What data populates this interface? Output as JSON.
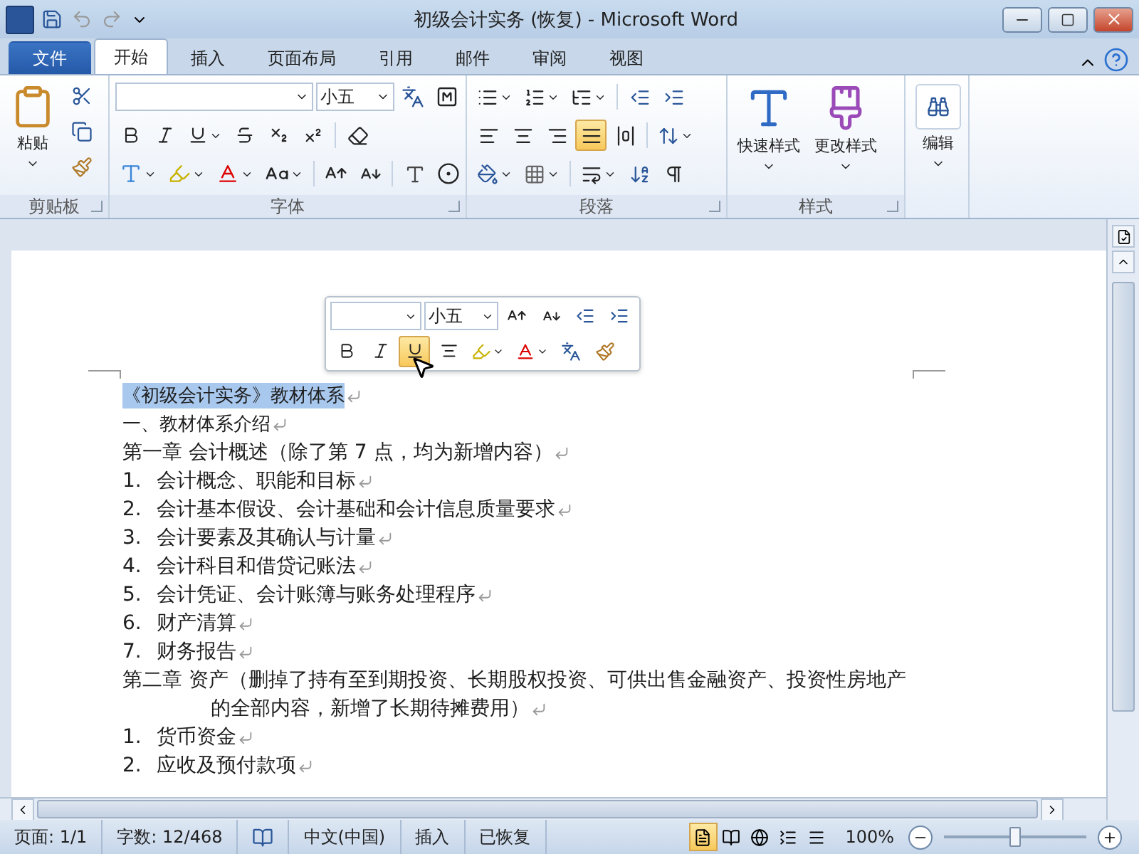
{
  "window": {
    "title": "初级会计实务 (恢复) - Microsoft Word"
  },
  "ribbon_tabs": [
    {
      "label": "文件",
      "kind": "file",
      "selected": false
    },
    {
      "label": "开始",
      "kind": "tab",
      "selected": true
    },
    {
      "label": "插入",
      "kind": "tab",
      "selected": false
    },
    {
      "label": "页面布局",
      "kind": "tab",
      "selected": false
    },
    {
      "label": "引用",
      "kind": "tab",
      "selected": false
    },
    {
      "label": "邮件",
      "kind": "tab",
      "selected": false
    },
    {
      "label": "审阅",
      "kind": "tab",
      "selected": false
    },
    {
      "label": "视图",
      "kind": "tab",
      "selected": false
    }
  ],
  "clipboard": {
    "paste_label": "粘贴",
    "group_label": "剪贴板"
  },
  "font": {
    "size": "小五",
    "group_label": "字体"
  },
  "paragraph": {
    "group_label": "段落",
    "alignments": [
      {
        "kind": "left",
        "selected": false
      },
      {
        "kind": "center",
        "selected": false
      },
      {
        "kind": "right",
        "selected": false
      },
      {
        "kind": "justify",
        "selected": true
      },
      {
        "kind": "distributed",
        "selected": false
      }
    ]
  },
  "styles": {
    "quick_styles": "快速样式",
    "change_styles": "更改样式",
    "group_label": "样式"
  },
  "editing": {
    "label": "编辑"
  },
  "mini_toolbar": {
    "size": "小五",
    "underline": {
      "selected": true
    }
  },
  "document": {
    "lines": [
      {
        "kind": "heading",
        "text": "《初级会计实务》教材体系",
        "selected": true
      },
      {
        "kind": "plain",
        "text": "一、教材体系介绍",
        "selected": false
      },
      {
        "kind": "chapter",
        "text": "第一章  会计概述（除了第 7 点，均为新增内容）",
        "selected": false
      },
      {
        "kind": "numbered",
        "number": "1.",
        "text": "会计概念、职能和目标",
        "selected": false
      },
      {
        "kind": "numbered",
        "number": "2.",
        "text": "会计基本假设、会计基础和会计信息质量要求",
        "selected": false
      },
      {
        "kind": "numbered",
        "number": "3.",
        "text": "会计要素及其确认与计量",
        "selected": false
      },
      {
        "kind": "numbered",
        "number": "4.",
        "text": "会计科目和借贷记账法",
        "selected": false
      },
      {
        "kind": "numbered",
        "number": "5.",
        "text": "会计凭证、会计账簿与账务处理程序",
        "selected": false
      },
      {
        "kind": "numbered",
        "number": "6.",
        "text": "财产清算",
        "selected": false
      },
      {
        "kind": "numbered",
        "number": "7.",
        "text": "财务报告",
        "selected": false
      },
      {
        "kind": "chapter_open",
        "text": "第二章  资产（删掉了持有至到期投资、长期股权投资、可供出售金融资产、投资性房地产",
        "selected": false
      },
      {
        "kind": "continuation",
        "text": "的全部内容，新增了长期待摊费用）",
        "selected": false
      },
      {
        "kind": "numbered",
        "number": "1.",
        "text": "货币资金",
        "selected": false
      },
      {
        "kind": "numbered",
        "number": "2.",
        "text": "应收及预付款项",
        "selected": false
      }
    ]
  },
  "status_bar": {
    "page": "页面: 1/1",
    "word_count": "字数: 12/468",
    "language": "中文(中国)",
    "mode": "插入",
    "recovery": "已恢复",
    "views": [
      {
        "kind": "print",
        "selected": true
      },
      {
        "kind": "reading",
        "selected": false
      },
      {
        "kind": "web",
        "selected": false
      },
      {
        "kind": "outline",
        "selected": false
      },
      {
        "kind": "draft",
        "selected": false
      }
    ],
    "zoom": "100%",
    "zoom_slider": {
      "level": 0.5
    }
  }
}
